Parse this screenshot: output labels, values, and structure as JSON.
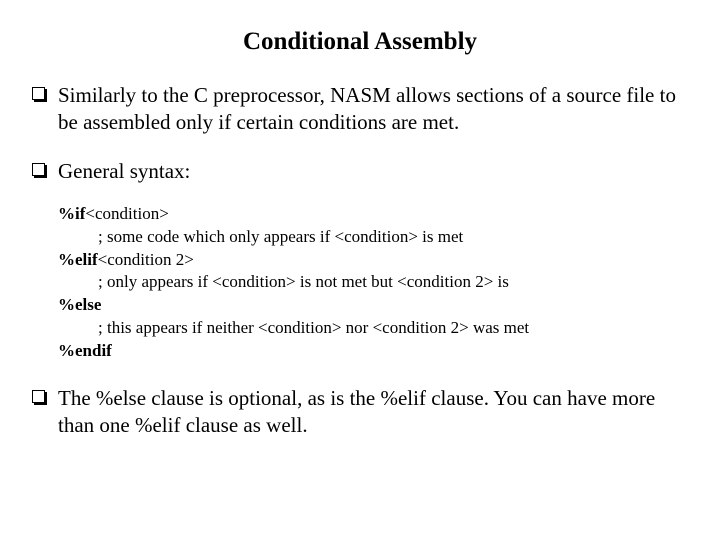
{
  "title": "Conditional Assembly",
  "bullets": [
    "Similarly to the C preprocessor, NASM allows sections of a source file to be assembled only if certain conditions are met.",
    "General syntax:",
    "The %else clause is optional, as is the %elif clause. You can have more than one %elif clause as well."
  ],
  "code": [
    {
      "kw": "%if",
      "rest": "<condition>"
    },
    {
      "kw": "",
      "rest": "; some code which only appears if <condition> is met"
    },
    {
      "kw": "%elif",
      "rest": "<condition 2>"
    },
    {
      "kw": "",
      "rest": "; only appears if <condition> is not met but <condition 2> is"
    },
    {
      "kw": "%else",
      "rest": ""
    },
    {
      "kw": "",
      "rest": "; this appears if neither <condition> nor <condition 2> was met"
    },
    {
      "kw": "%endif",
      "rest": ""
    }
  ]
}
